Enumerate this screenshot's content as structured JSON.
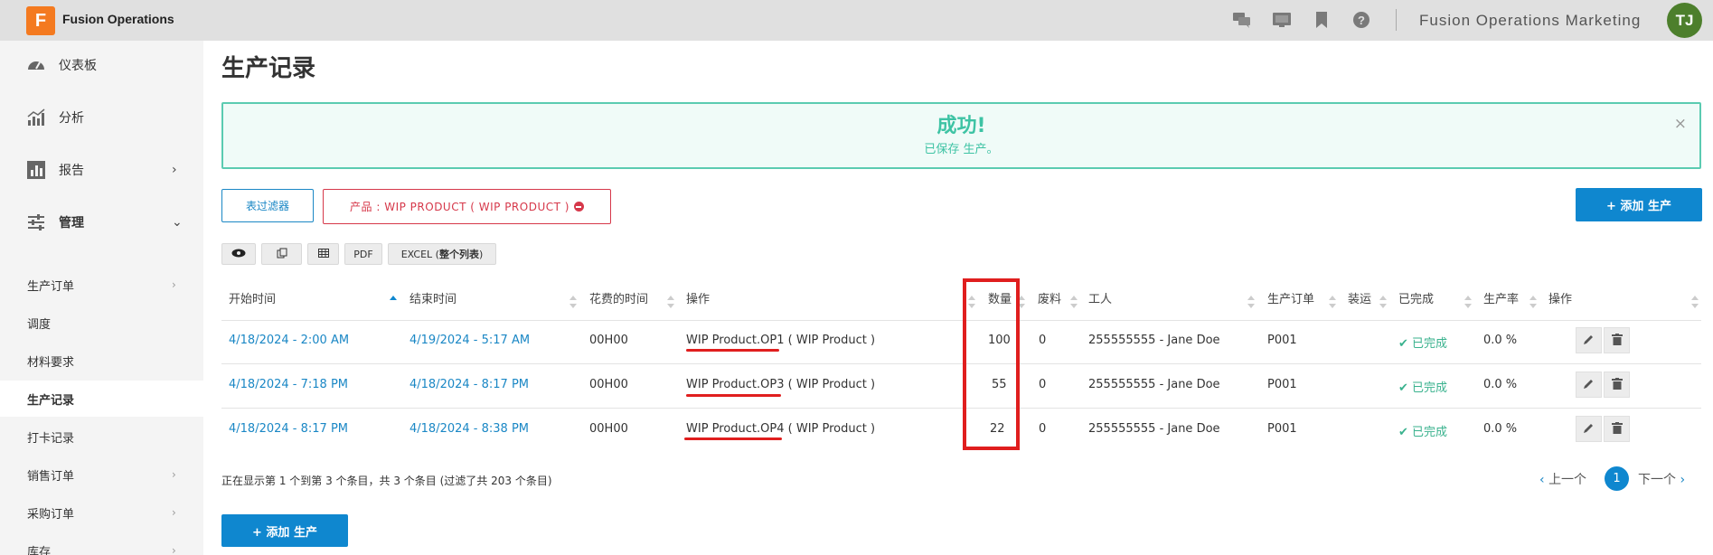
{
  "app": {
    "logo_letter": "F",
    "title": "Fusion Operations",
    "tenant": "Fusion Operations Marketing",
    "user_initials": "TJ"
  },
  "colors": {
    "accent": "#0f87cf",
    "success": "#3ec3a4",
    "danger": "#d6384a",
    "logo": "#f47a20",
    "avatar": "#4d7f2c"
  },
  "topbar_icons": [
    "chat-icon",
    "display-icon",
    "bookmark-icon",
    "help-icon"
  ],
  "sidebar": {
    "main": [
      {
        "label": "仪表板",
        "icon": "dashboard-icon"
      },
      {
        "label": "分析",
        "icon": "analytics-icon"
      },
      {
        "label": "报告",
        "icon": "report-icon"
      },
      {
        "label": "管理",
        "icon": "sliders-icon"
      }
    ],
    "sub": [
      {
        "label": "生产订单"
      },
      {
        "label": "调度"
      },
      {
        "label": "材料要求"
      },
      {
        "label": "生产记录"
      },
      {
        "label": "打卡记录"
      },
      {
        "label": "销售订单"
      },
      {
        "label": "采购订单"
      },
      {
        "label": "库存"
      }
    ]
  },
  "page": {
    "title": "生产记录"
  },
  "alert": {
    "title": "成功!",
    "message": "已保存 生产。",
    "close": "×"
  },
  "filters": {
    "filter_button": "表过滤器",
    "chip": "产品 : WIP PRODUCT ( WIP PRODUCT )"
  },
  "actions": {
    "add_top": "+ 添加 生产",
    "add_bottom": "+ 添加 生产"
  },
  "toolbar": {
    "pdf": "PDF",
    "excel_prefix": "EXCEL (",
    "excel_bold": "整个列表",
    "excel_suffix": ")"
  },
  "table": {
    "headers": [
      "开始时间",
      "结束时间",
      "花费的时间",
      "操作",
      "数量",
      "废料",
      "工人",
      "生产订单",
      "装运",
      "已完成",
      "生产率",
      "操作"
    ],
    "rows": [
      {
        "start": "4/18/2024 - 2:00 AM",
        "end": "4/19/2024 - 5:17 AM",
        "elapsed": "00H00",
        "op": "WIP Product.OP1",
        "product": " ( WIP Product )",
        "qty": "100",
        "scrap": "0",
        "worker": "255555555 - Jane Doe",
        "order": "P001",
        "done": "已完成",
        "rate": "0.0 %"
      },
      {
        "start": "4/18/2024 - 7:18 PM",
        "end": "4/18/2024 - 8:17 PM",
        "elapsed": "00H00",
        "op": "WIP Product.OP3",
        "product": " ( WIP Product )",
        "qty": "55",
        "scrap": "0",
        "worker": "255555555 - Jane Doe",
        "order": "P001",
        "done": "已完成",
        "rate": "0.0 %"
      },
      {
        "start": "4/18/2024 - 8:17 PM",
        "end": "4/18/2024 - 8:38 PM",
        "elapsed": "00H00",
        "op": "WIP Product.OP4",
        "product": " ( WIP Product )",
        "qty": "22",
        "scrap": "0",
        "worker": "255555555 - Jane Doe",
        "order": "P001",
        "done": "已完成",
        "rate": "0.0 %"
      }
    ]
  },
  "footer": {
    "info": "正在显示第 1 个到第 3 个条目，共 3 个条目 (过滤了共 203 个条目)"
  },
  "pager": {
    "prev": "上一个",
    "current": "1",
    "next": "下一个"
  }
}
